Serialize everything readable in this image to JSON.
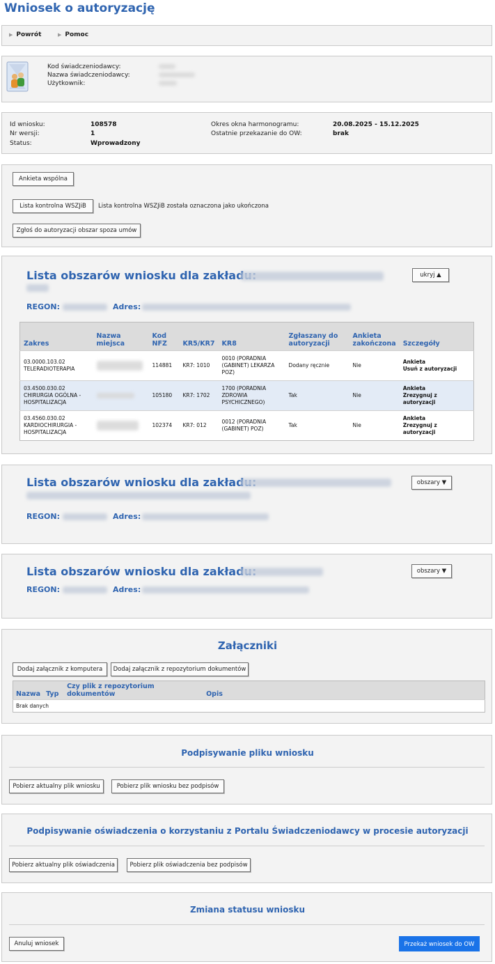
{
  "page": {
    "title": "Wniosek o autoryzację"
  },
  "nav": {
    "back": "Powrót",
    "help": "Pomoc"
  },
  "provider": {
    "code_label": "Kod świadczeniodawcy:",
    "name_label": "Nazwa świadczeniodawcy:",
    "user_label": "Użytkownik:"
  },
  "info": {
    "id_label": "Id wniosku:",
    "id_value": "108578",
    "version_label": "Nr wersji:",
    "version_value": "1",
    "status_label": "Status:",
    "status_value": "Wprowadzony",
    "window_label": "Okres okna harmonogramu:",
    "window_value": "20.08.2025 - 15.12.2025",
    "last_label": "Ostatnie przekazanie do OW:",
    "last_value": "brak"
  },
  "actions": {
    "survey_common": "Ankieta wspólna",
    "checklist": "Lista kontrolna WSZJiB",
    "checklist_status": "Lista kontrolna WSZJiB została oznaczona jako ukończona",
    "report_area": "Zgłoś do autoryzacji obszar spoza umów"
  },
  "facilities": [
    {
      "heading": "Lista obszarów wniosku dla zakładu:",
      "regon_label": "REGON:",
      "address_label": "Adres:",
      "toggle": "ukryj ▲",
      "table": {
        "headers": [
          "Zakres",
          "Nazwa miejsca",
          "Kod NFZ",
          "KR5/KR7",
          "KR8",
          "Zgłaszany do autoryzacji",
          "Ankieta zakończona",
          "Szczegóły"
        ],
        "rows": [
          {
            "zakres": "03.0000.103.02 TELERADIOTERAPIA",
            "kod": "114881",
            "kr": "KR7:  1010",
            "kr8": "0010 (PORADNIA (GABINET) LEKARZA POZ)",
            "zgl": "Dodany ręcznie",
            "ank": "Nie",
            "det1": "Ankieta",
            "det2": "Usuń z autoryzacji"
          },
          {
            "zakres": "03.4500.030.02 CHIRURGIA OGÓLNA - HOSPITALIZACJA",
            "kod": "105180",
            "kr": "KR7:  1702",
            "kr8": "1700 (PORADNIA ZDROWIA PSYCHICZNEGO)",
            "zgl": "Tak",
            "ank": "Nie",
            "det1": "Ankieta",
            "det2": "Zrezygnuj z autoryzacji"
          },
          {
            "zakres": "03.4560.030.02 KARDIOCHIRURGIA - HOSPITALIZACJA",
            "kod": "102374",
            "kr": "KR7:  012",
            "kr8": "0012 (PORADNIA (GABINET) POZ)",
            "zgl": "Tak",
            "ank": "Nie",
            "det1": "Ankieta",
            "det2": "Zrezygnuj z autoryzacji"
          }
        ]
      }
    },
    {
      "heading": "Lista obszarów wniosku dla zakładu:",
      "regon_label": "REGON:",
      "address_label": "Adres:",
      "toggle": "obszary ▼"
    },
    {
      "heading": "Lista obszarów wniosku dla zakładu:",
      "regon_label": "REGON:",
      "address_label": "Adres:",
      "toggle": "obszary ▼"
    }
  ],
  "attachments": {
    "title": "Załączniki",
    "add_computer": "Dodaj załącznik z komputera",
    "add_repo": "Dodaj załącznik z repozytorium dokumentów",
    "headers": [
      "Nazwa",
      "Typ",
      "Czy plik z repozytorium dokumentów",
      "Opis"
    ],
    "empty": "Brak danych"
  },
  "signing_file": {
    "title": "Podpisywanie pliku wniosku",
    "download_current": "Pobierz aktualny plik wniosku",
    "download_unsigned": "Pobierz plik wniosku bez podpisów"
  },
  "signing_statement": {
    "title": "Podpisywanie oświadczenia o korzystaniu z Portalu Świadczeniodawcy w procesie autoryzacji",
    "download_current": "Pobierz aktualny plik oświadczenia",
    "download_unsigned": "Pobierz plik oświadczenia bez podpisów"
  },
  "status_change": {
    "title": "Zmiana statusu wniosku",
    "cancel": "Anuluj wniosek",
    "submit": "Przekaż wniosek do OW"
  },
  "colors": {
    "accent": "#2f64b0",
    "primary_button": "#1a73e8",
    "panel_bg": "#f3f3f3",
    "highlight_row": "#e3ebf6"
  }
}
